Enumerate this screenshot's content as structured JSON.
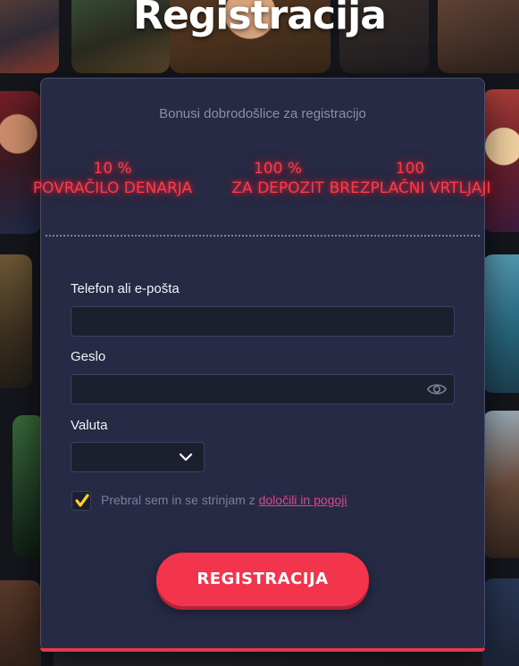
{
  "page": {
    "title": "Registracija"
  },
  "bonuses": {
    "heading": "Bonusi dobrodošlice za registracijo",
    "items": [
      {
        "value": "10 %",
        "label": "POVRAČILO DENARJA"
      },
      {
        "value": "100 %",
        "label": "ZA DEPOZIT"
      },
      {
        "value": "100",
        "label": "BREZPLAČNI VRTLJAJI"
      }
    ]
  },
  "form": {
    "phone_label": "Telefon ali e-pošta",
    "phone_value": "",
    "password_label": "Geslo",
    "password_value": "",
    "currency_label": "Valuta",
    "currency_value": "",
    "agree_text": "Prebral sem in se strinjam z ",
    "agree_link": "določili in pogoji",
    "agree_checked": true,
    "submit_label": "REGISTRACIJA"
  },
  "colors": {
    "accent": "#f2344d",
    "neon": "#ff3a47",
    "link": "#e0458e",
    "checkbox": "#ffd21f",
    "card": "#262a44"
  },
  "icons": {
    "password_toggle": "eye-icon",
    "select_arrow": "chevron-down-icon",
    "check": "checkmark-icon"
  }
}
